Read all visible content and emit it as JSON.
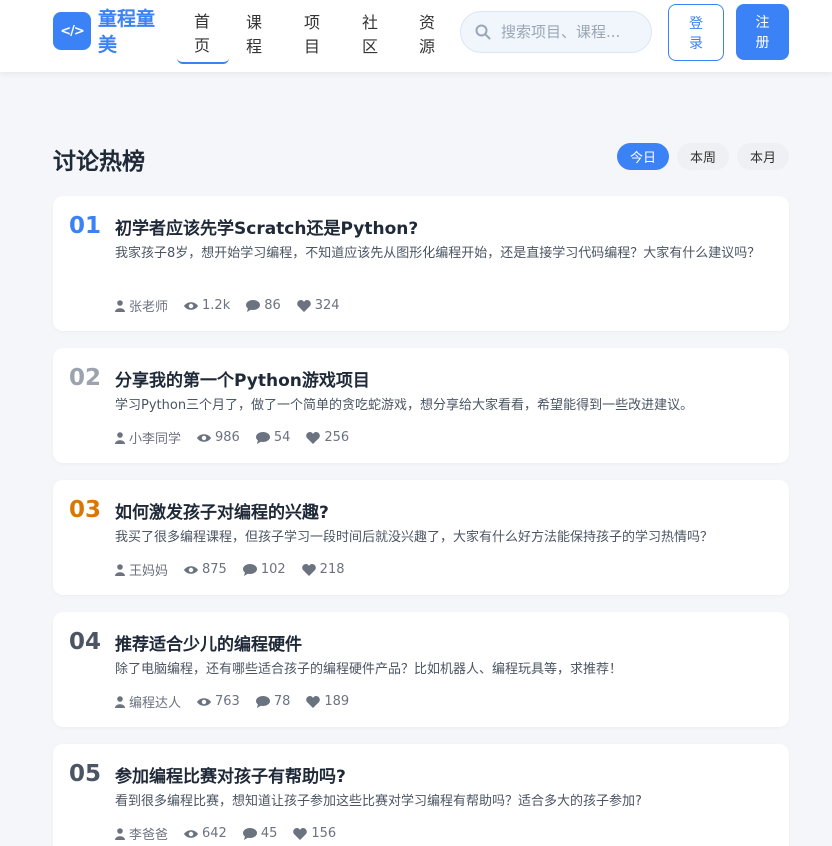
{
  "header": {
    "logo_glyph": "</>",
    "brand": "童程童美",
    "nav": [
      {
        "label": "首页",
        "active": true
      },
      {
        "label": "课程",
        "active": false
      },
      {
        "label": "项目",
        "active": false
      },
      {
        "label": "社区",
        "active": false
      },
      {
        "label": "资源",
        "active": false
      }
    ],
    "search_placeholder": "搜索项目、课程...",
    "login_label": "登录",
    "register_label": "注册"
  },
  "section": {
    "title": "讨论热榜",
    "filters": [
      {
        "label": "今日",
        "active": true
      },
      {
        "label": "本周",
        "active": false
      },
      {
        "label": "本月",
        "active": false
      }
    ]
  },
  "colors": {
    "accent": "#3b82f6",
    "rank1": "#3b82f6",
    "rank2": "#9ca3af",
    "rank3": "#d97706",
    "rank_other": "#4b5563"
  },
  "posts": [
    {
      "rank": "01",
      "title": "初学者应该先学Scratch还是Python?",
      "desc": "我家孩子8岁，想开始学习编程，不知道应该先从图形化编程开始，还是直接学习代码编程？大家有什么建议吗？",
      "author": "张老师",
      "views": "1.2k",
      "comments": "86",
      "likes": "324"
    },
    {
      "rank": "02",
      "title": "分享我的第一个Python游戏项目",
      "desc": "学习Python三个月了，做了一个简单的贪吃蛇游戏，想分享给大家看看，希望能得到一些改进建议。",
      "author": "小李同学",
      "views": "986",
      "comments": "54",
      "likes": "256"
    },
    {
      "rank": "03",
      "title": "如何激发孩子对编程的兴趣?",
      "desc": "我买了很多编程课程，但孩子学习一段时间后就没兴趣了，大家有什么好方法能保持孩子的学习热情吗？",
      "author": "王妈妈",
      "views": "875",
      "comments": "102",
      "likes": "218"
    },
    {
      "rank": "04",
      "title": "推荐适合少儿的编程硬件",
      "desc": "除了电脑编程，还有哪些适合孩子的编程硬件产品？比如机器人、编程玩具等，求推荐！",
      "author": "编程达人",
      "views": "763",
      "comments": "78",
      "likes": "189"
    },
    {
      "rank": "05",
      "title": "参加编程比赛对孩子有帮助吗?",
      "desc": "看到很多编程比赛，想知道让孩子参加这些比赛对学习编程有帮助吗？适合多大的孩子参加?",
      "author": "李爸爸",
      "views": "642",
      "comments": "45",
      "likes": "156"
    }
  ]
}
